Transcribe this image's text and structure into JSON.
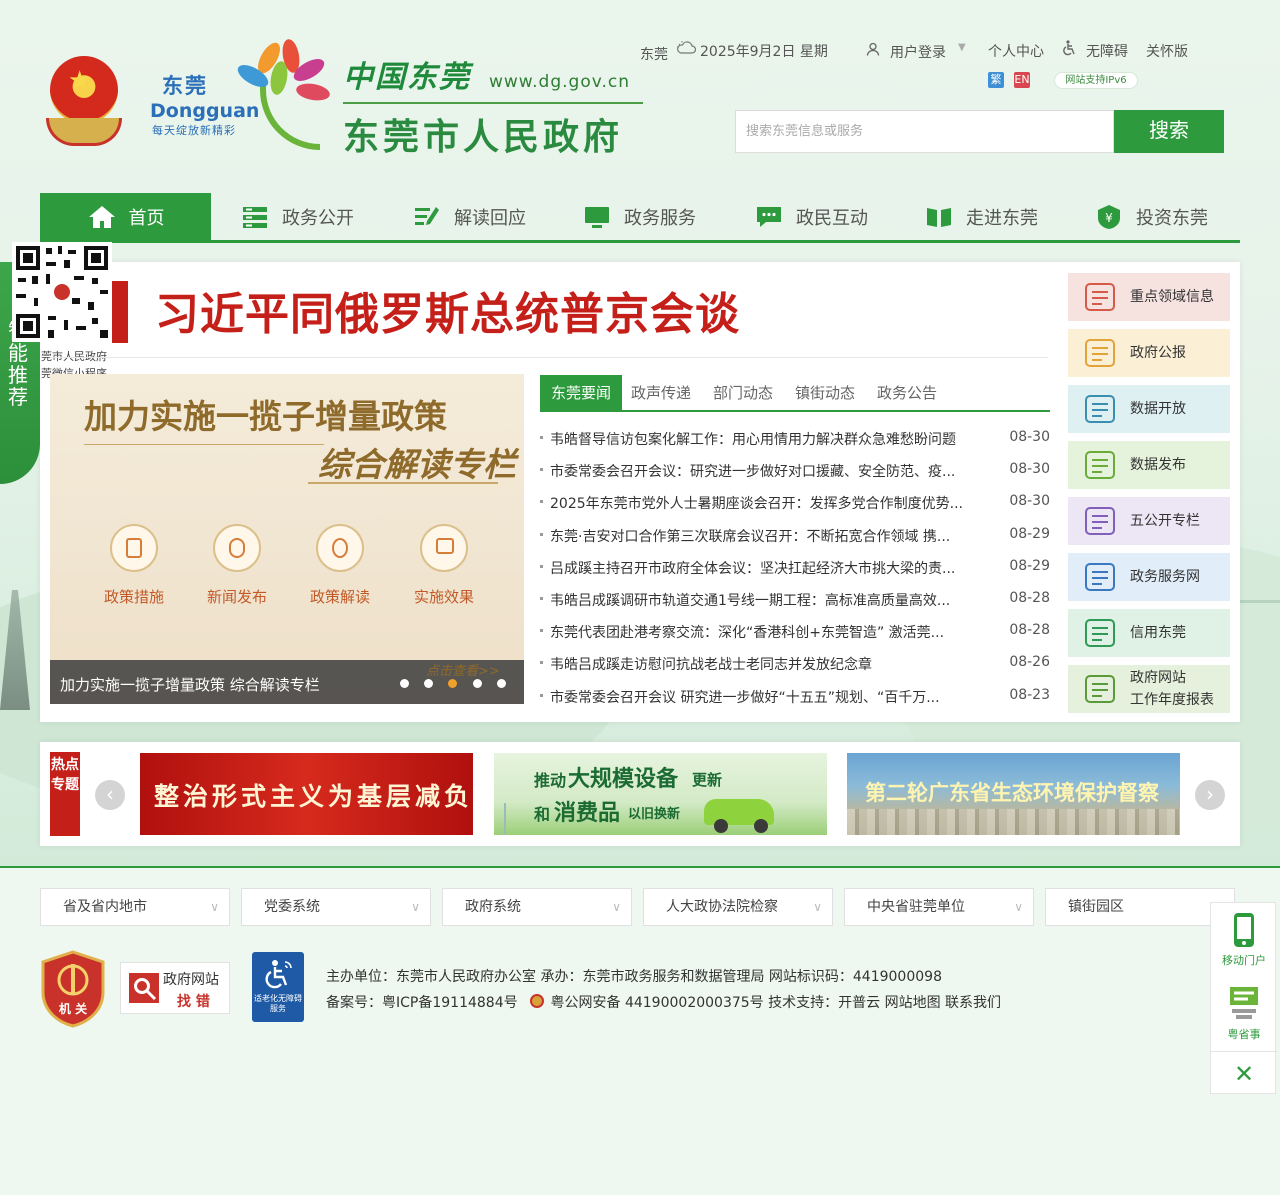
{
  "header": {
    "logo_cn": "东莞",
    "logo_en": "Dongguan",
    "logo_slogan": "每天绽放新精彩",
    "brand_cn": "中国东莞",
    "url": "www.dg.gov.cn",
    "site_title": "东莞市人民政府"
  },
  "topbar": {
    "city": "东莞",
    "date": "2025年9月2日 星期",
    "login": "用户登录",
    "user_center": "个人中心",
    "accessibility": "无障碍",
    "care": "关怀版",
    "lang_tc": "繁",
    "lang_en": "EN",
    "ipv6": "网站支持IPv6"
  },
  "search": {
    "placeholder": "搜索东莞信息或服务",
    "button": "搜索"
  },
  "nav": [
    "首页",
    "政务公开",
    "解读回应",
    "政务服务",
    "政民互动",
    "走进东莞",
    "投资东莞"
  ],
  "qr": {
    "caption1": "莞市人民政府",
    "caption2": "莞微信小程序"
  },
  "smart_tab": {
    "arrows": "»",
    "label": "智能推荐"
  },
  "headline": "习近平同俄罗斯总统普京会谈",
  "slide": {
    "title1": "加力实施一揽子增量政策",
    "title2": "综合解读专栏",
    "cats": [
      "政策措施",
      "新闻发布",
      "政策解读",
      "实施效果"
    ],
    "caption": "加力实施一揽子增量政策 综合解读专栏",
    "more": "点击查看>>"
  },
  "news_tabs": [
    "东莞要闻",
    "政声传递",
    "部门动态",
    "镇街动态",
    "政务公告"
  ],
  "news": [
    {
      "title": "韦皓督导信访包案化解工作：用心用情用力解决群众急难愁盼问题",
      "date": "08-30"
    },
    {
      "title": "市委常委会召开会议：研究进一步做好对口援藏、安全防范、疫...",
      "date": "08-30"
    },
    {
      "title": "2025年东莞市党外人士暑期座谈会召开：发挥多党合作制度优势...",
      "date": "08-30"
    },
    {
      "title": "东莞·吉安对口合作第三次联席会议召开：不断拓宽合作领域 携...",
      "date": "08-29"
    },
    {
      "title": "吕成蹊主持召开市政府全体会议：坚决扛起经济大市挑大梁的责...",
      "date": "08-29"
    },
    {
      "title": "韦皓吕成蹊调研市轨道交通1号线一期工程：高标准高质量高效...",
      "date": "08-28"
    },
    {
      "title": "东莞代表团赴港考察交流：深化“香港科创+东莞智造” 激活莞...",
      "date": "08-28"
    },
    {
      "title": "韦皓吕成蹊走访慰问抗战老战士老同志并发放纪念章",
      "date": "08-26"
    },
    {
      "title": "市委常委会召开会议 研究进一步做好“十五五”规划、“百千万...",
      "date": "08-23"
    }
  ],
  "quick_links": [
    {
      "label": "重点领域信息",
      "color": "#f6e3e0",
      "accent": "#d65a4a"
    },
    {
      "label": "政府公报",
      "color": "#fbefd6",
      "accent": "#e0a43a"
    },
    {
      "label": "数据开放",
      "color": "#dff0f3",
      "accent": "#3a8fb0"
    },
    {
      "label": "数据发布",
      "color": "#e6f3dc",
      "accent": "#6aac3a"
    },
    {
      "label": "五公开专栏",
      "color": "#ece6f5",
      "accent": "#8060b8"
    },
    {
      "label": "政务服务网",
      "color": "#e1eef9",
      "accent": "#3a78c0"
    },
    {
      "label": "信用东莞",
      "color": "#e0f2e6",
      "accent": "#2e9a55"
    },
    {
      "label": "政府网站工作年度报表",
      "label_line1": "政府网站",
      "label_line2": "工作年度报表",
      "color": "#e6f1dd",
      "accent": "#5a9a3a"
    }
  ],
  "hot": {
    "label": "热点专题",
    "banner1": "整治形式主义为基层减负",
    "banner2_a": "推动",
    "banner2_b": "大规模设备",
    "banner2_c": "更新",
    "banner2_d": "和",
    "banner2_e": "消费品",
    "banner2_f": "以旧换新",
    "banner3": "第二轮广东省生态环境保护督察"
  },
  "footer": {
    "selects": [
      "省及省内地市",
      "党委系统",
      "政府系统",
      "人大政协法院检察",
      "中央省驻莞单位",
      "镇街园区"
    ],
    "badge_jg": "机 关",
    "badge_err_1": "政府网站",
    "badge_err_2": "找 错",
    "badge_acc": "适老化无障碍服务",
    "line1": "主办单位：东莞市人民政府办公室  承办：东莞市政务服务和数据管理局  网站标识码：4419000098",
    "line2_a": "备案号：粤ICP备19114884号",
    "line2_b": "粤公网安备 44190002000375号  技术支持：开普云   网站地图   联系我们"
  },
  "float": {
    "mobile": "移动门户",
    "yss": "粤省事",
    "close": "✕"
  },
  "colors": {
    "primary": "#2e9a3e",
    "headline_red": "#c51f1a"
  }
}
